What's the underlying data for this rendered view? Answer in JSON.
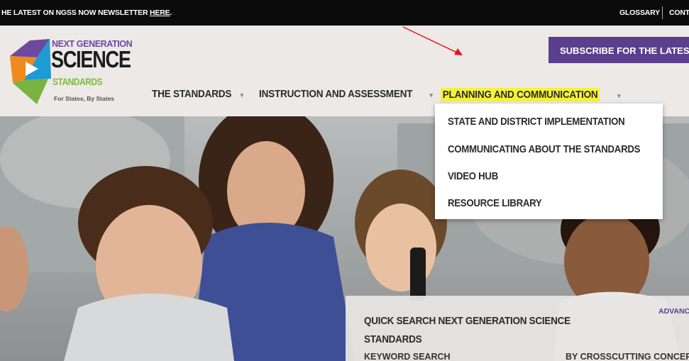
{
  "topbar": {
    "newsletter_text": "HE LATEST ON NGSS NOW NEWSLETTER",
    "newsletter_link": "HERE",
    "newsletter_end": ".",
    "glossary": "GLOSSARY",
    "contact": "CONT"
  },
  "logo": {
    "line1": "NEXT GENERATION",
    "line2": "SCIENCE",
    "line3": "STANDARDS",
    "tagline": "For States, By States"
  },
  "subscribe_button": "SUBSCRIBE FOR THE LATEST",
  "nav": {
    "standards": "THE STANDARDS",
    "instruction": "INSTRUCTION AND ASSESSMENT",
    "planning": "PLANNING AND COMMUNICATION",
    "caret": "▾"
  },
  "dropdown": {
    "items": [
      "STATE AND DISTRICT IMPLEMENTATION",
      "COMMUNICATING ABOUT THE STANDARDS",
      "VIDEO HUB",
      "RESOURCE LIBRARY"
    ]
  },
  "quick_search": {
    "title_line1": "QUICK SEARCH NEXT GENERATION SCIENCE",
    "title_line2": "STANDARDS",
    "advanced": "ADVANC",
    "keyword_label": "KEYWORD SEARCH",
    "crosscutting_label": "BY CROSSCUTTING CONCEP"
  },
  "colors": {
    "brand_purple": "#5b3f8e",
    "highlight_yellow": "#f6f23a",
    "annotation_arrow": "#e8141a"
  }
}
